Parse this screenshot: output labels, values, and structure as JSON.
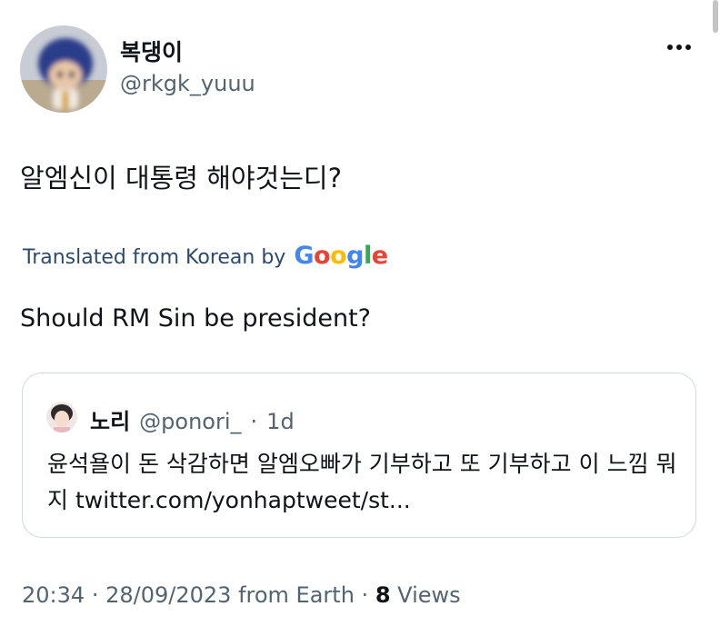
{
  "author": {
    "display_name": "복댕이",
    "handle": "@rkgk_yuuu"
  },
  "tweet": {
    "text": "알엠신이 대통령 해야것는디?",
    "translation_label": "Translated from Korean by",
    "translation_provider": "Google",
    "translation": "Should RM Sin be president?"
  },
  "quoted_tweet": {
    "display_name": "노리",
    "handle": "@ponori_",
    "separator": "·",
    "time_ago": "1d",
    "text": "윤석욜이 돈 삭감하면 알엠오빠가 기부하고 또 기부하고 이 느낌 뭐지 twitter.com/yonhaptweet/st..."
  },
  "meta": {
    "time": "20:34",
    "date": "28/09/2023",
    "source": "from Earth",
    "separator": "·",
    "views_count": "8",
    "views_label": "Views"
  },
  "colors": {
    "text_primary": "#0f1419",
    "text_secondary": "#536471",
    "translated_label": "#2b4b6b",
    "card_border": "#cfd9de",
    "google_blue": "#4285f4",
    "google_red": "#ea4335",
    "google_yellow": "#fbbc05",
    "google_green": "#34a853"
  },
  "icons": {
    "more": "more-horizontal-icon"
  }
}
